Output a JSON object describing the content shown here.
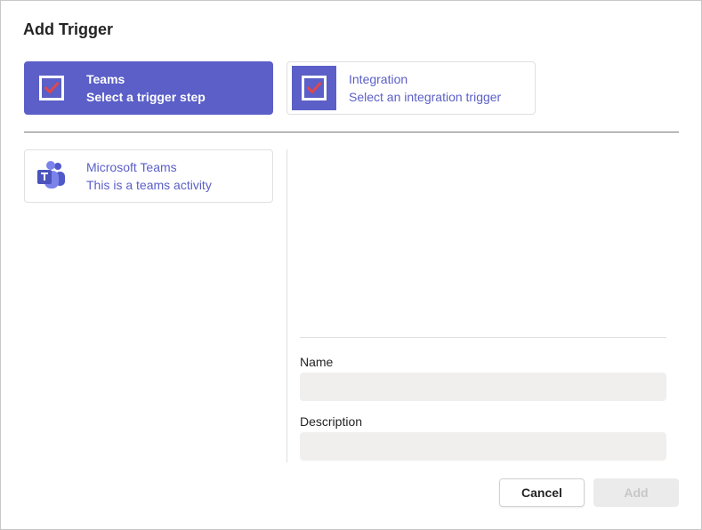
{
  "dialog": {
    "title": "Add Trigger"
  },
  "triggers": [
    {
      "name": "Teams",
      "description": "Select a trigger step",
      "selected": true,
      "icon": "checkbox-checked-icon"
    },
    {
      "name": "Integration",
      "description": "Select an integration trigger",
      "selected": false,
      "icon": "checkbox-checked-icon"
    }
  ],
  "activities": [
    {
      "name": "Microsoft Teams",
      "description": "This is a teams activity",
      "icon": "microsoft-teams-icon"
    }
  ],
  "form": {
    "name_label": "Name",
    "name_value": "",
    "description_label": "Description",
    "description_value": ""
  },
  "buttons": {
    "cancel": "Cancel",
    "add": "Add",
    "add_disabled": true
  },
  "colors": {
    "accent": "#5b5fc7",
    "check": "#e0474c",
    "input_bg": "#f0efee"
  }
}
